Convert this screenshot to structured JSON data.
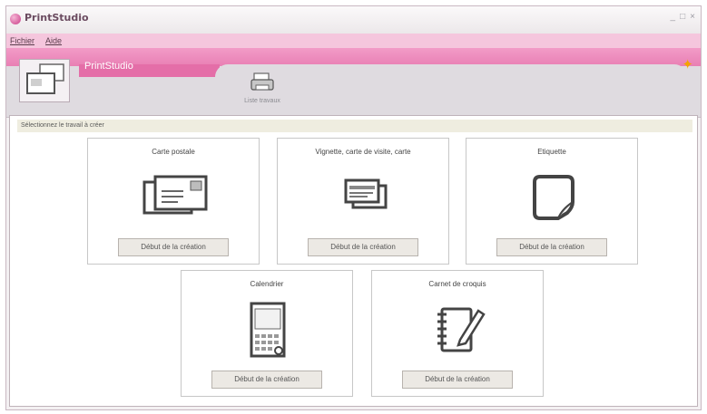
{
  "window": {
    "title": "PrintStudio",
    "controls": [
      "_",
      "□",
      "×"
    ]
  },
  "menu": [
    "Fichier",
    "Aide"
  ],
  "header": {
    "app_name": "PrintStudio"
  },
  "tab": {
    "label": "Liste travaux"
  },
  "instruction": "Sélectionnez le travail à créer",
  "cards": [
    {
      "title": "Carte postale",
      "button": "Début de la création",
      "icon": "postcard-icon"
    },
    {
      "title": "Vignette, carte de visite, carte",
      "button": "Début de la création",
      "icon": "business-card-icon"
    },
    {
      "title": "Etiquette",
      "button": "Début de la création",
      "icon": "sticker-label-icon"
    },
    {
      "title": "Calendrier",
      "button": "Début de la création",
      "icon": "calendar-icon"
    },
    {
      "title": "Carnet de croquis",
      "button": "Début de la création",
      "icon": "sketchbook-icon"
    }
  ],
  "colors": {
    "accent_pink": "#e36fa8",
    "menu_pink": "#f5c6dd",
    "instruction_bar": "#efede0"
  }
}
